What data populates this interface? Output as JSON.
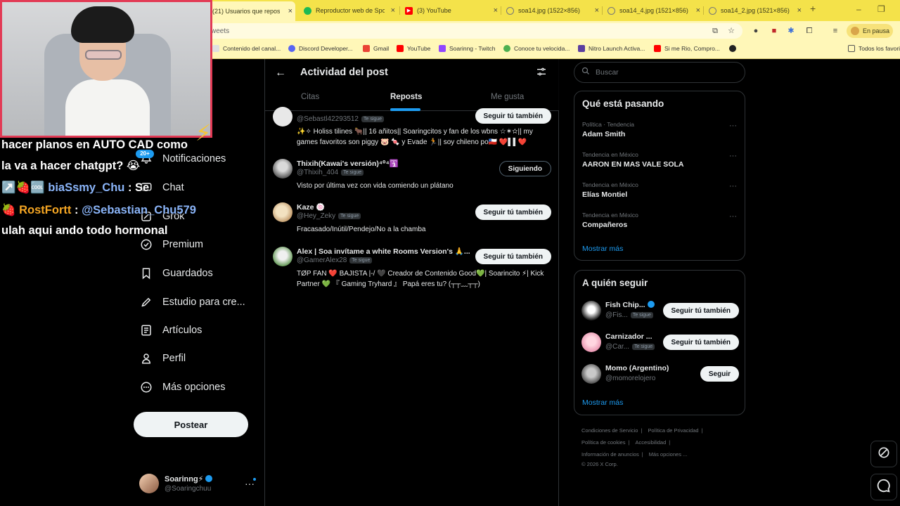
{
  "browser": {
    "tabs": [
      {
        "title": "(21) Usuarios que reposte",
        "favicon_color": "#000000"
      },
      {
        "title": "Reproductor web de Spot",
        "favicon_color": "#1db954"
      },
      {
        "title": "(3) YouTube",
        "favicon_color": "#ff0000"
      },
      {
        "title": "soa14.jpg (1522×856)",
        "favicon_color": "#777777"
      },
      {
        "title": "soa14_4.jpg (1521×856)",
        "favicon_color": "#777777"
      },
      {
        "title": "soa14_2.jpg (1521×856)",
        "favicon_color": "#777777"
      }
    ],
    "new_tab": "+",
    "address": "weets",
    "paused_label": "En pausa",
    "bookmarks": [
      {
        "label": "Contenido del canal..."
      },
      {
        "label": "Discord Developer..."
      },
      {
        "label": "Gmail"
      },
      {
        "label": "YouTube"
      },
      {
        "label": "Soarinng - Twitch"
      },
      {
        "label": "Conoce tu velocida..."
      },
      {
        "label": "Nitro Launch Activa..."
      },
      {
        "label": "Si me Rio, Compro..."
      },
      {
        "label": "Todos los favori"
      }
    ]
  },
  "nav": {
    "items": [
      {
        "label": "Notificaciones",
        "icon": "bell-icon"
      },
      {
        "label": "Chat",
        "icon": "chat-icon"
      },
      {
        "label": "Grok",
        "icon": "grok-icon"
      },
      {
        "label": "Premium",
        "icon": "verified-icon"
      },
      {
        "label": "Guardados",
        "icon": "bookmark-icon"
      },
      {
        "label": "Estudio para cre...",
        "icon": "rocket-icon"
      },
      {
        "label": "Artículos",
        "icon": "article-icon"
      },
      {
        "label": "Perfil",
        "icon": "person-icon"
      },
      {
        "label": "Más opciones",
        "icon": "more-circle-icon"
      }
    ],
    "notif_badge": "20+",
    "post_label": "Postear",
    "account": {
      "name": "Soarinng⚡",
      "handle": "@Soaringchuu"
    }
  },
  "center": {
    "title": "Actividad del post",
    "tabs": [
      "Citas",
      "Reposts",
      "Me gusta"
    ],
    "selected_tab": "Reposts",
    "users": [
      {
        "name": "",
        "handle": "@Sebastl42293512",
        "follows_you": "Te sigue",
        "bio": "✨✧ Holiss tilines 🐂|| 16 añitos|| Soaringcitos y fan de los wbns ☆✶✫|| my games favoritos son piggy 🐷 🍬 y Evade 🏃|| soy chileno po🇨🇱 ❤️▌▌❤️",
        "button": "Seguir tú también"
      },
      {
        "name": "Thixih(Kawai's versión)⁴⁰⁴🛐",
        "handle": "@Thixih_404",
        "follows_you": "Te sigue",
        "bio": "Visto por última vez con vida comiendo un plátano",
        "button": "Siguiendo"
      },
      {
        "name": "Kaze 🍥",
        "handle": "@Hey_Zeky",
        "follows_you": "Te sigue",
        "bio": "Fracasado/Inútil/Pendejo/No a la chamba",
        "button": "Seguir tú también"
      },
      {
        "name": "Alex | Soa invítame a white Rooms Version's 🙏...",
        "handle": "@GamerAlex28",
        "follows_you": "Te sigue",
        "bio": "TØP FAN ❤️ BAJISTA |-/ 🖤 Creador de Contenido Good💚| Soarincito ⚡| Kick Partner 💚 『 Gaming Tryhard 』 Papá eres tu? (┬┬﹏┬┬)",
        "button": "Seguir tú también"
      }
    ]
  },
  "right": {
    "search_placeholder": "Buscar",
    "trends_title": "Qué está pasando",
    "trends": [
      {
        "context": "Política · Tendencia",
        "name": "Adam Smith"
      },
      {
        "context": "Tendencia en México",
        "name": "AARON EN MAS VALE SOLA"
      },
      {
        "context": "Tendencia en México",
        "name": "Elías Montiel"
      },
      {
        "context": "Tendencia en México",
        "name": "Compañeros"
      }
    ],
    "show_more": "Mostrar más",
    "who_title": "A quién seguir",
    "who": [
      {
        "name": "Fish Chip...",
        "handle": "@Fis...",
        "follows_you": "Te sigue",
        "button": "Seguir tú también",
        "verified": true
      },
      {
        "name": "Carnizador ...",
        "handle": "@Car...",
        "follows_you": "Te sigue",
        "button": "Seguir tú también",
        "verified": false
      },
      {
        "name": "Momo (Argentino)",
        "handle": "@momorelojero",
        "follows_you": "",
        "button": "Seguir",
        "verified": false
      }
    ],
    "who_show_more": "Mostrar más",
    "footer": {
      "links": [
        "Condiciones de Servicio",
        "Política de Privacidad",
        "Política de cookies",
        "Accesibilidad",
        "Información de anuncios",
        "Más opciones ..."
      ],
      "copyright": "© 2026 X Corp."
    }
  },
  "overlay": {
    "chat": [
      {
        "text": "hacer planos en AUTO CAD como"
      },
      {
        "text": "la va a hacer chatgpt? 😭"
      },
      {
        "badges": "↗️🍓🆒",
        "user": "biaSsmy_Chu",
        "sep": ":",
        "text": "Se"
      },
      {
        "badges": "🍓",
        "user": "RostFortt",
        "sep": ":",
        "text": "@Sebastian_Chu579"
      },
      {
        "text": "ulah aqui ando todo hormonal"
      }
    ]
  }
}
